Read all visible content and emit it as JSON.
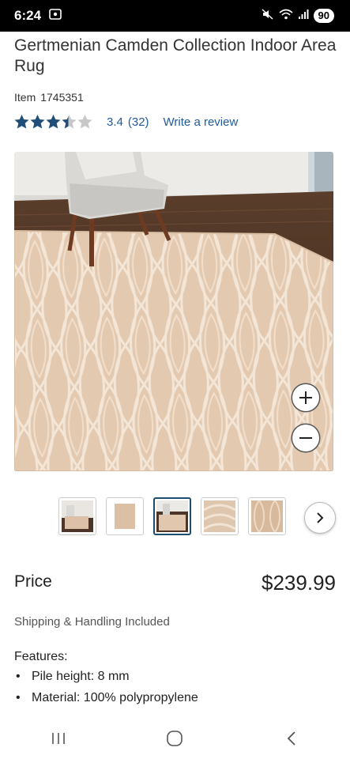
{
  "status_bar": {
    "time": "6:24",
    "battery": "90",
    "icons": [
      "screenshot-icon",
      "mute-icon",
      "wifi-icon",
      "signal-icon"
    ]
  },
  "product": {
    "title": "Gertmenian Camden Collection Indoor Area Rug",
    "item_label": "Item",
    "item_number": "1745351",
    "rating": 3.4,
    "rating_text": "3.4",
    "review_count": "(32)",
    "write_review": "Write a review",
    "star_color": "#1e4e79"
  },
  "gallery": {
    "zoom_in_icon": "plus-icon",
    "zoom_out_icon": "minus-icon",
    "selected_thumbnail": 3,
    "next_icon": "chevron-right-icon"
  },
  "pricing": {
    "label": "Price",
    "value": "$239.99",
    "shipping": "Shipping & Handling Included"
  },
  "features": {
    "heading": "Features:",
    "items": [
      "Pile height: 8 mm",
      "Material: 100% polypropylene"
    ]
  },
  "nav_bar": {
    "icons": [
      "recent-apps-icon",
      "home-icon",
      "back-icon"
    ]
  }
}
